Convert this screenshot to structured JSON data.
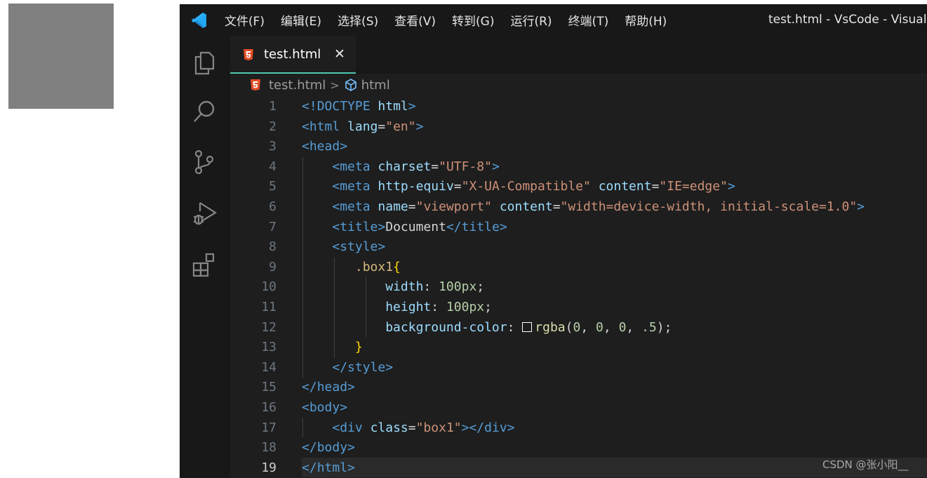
{
  "window": {
    "title": "test.html - VsCode - Visual St",
    "menu": [
      "文件(F)",
      "编辑(E)",
      "选择(S)",
      "查看(V)",
      "转到(G)",
      "运行(R)",
      "终端(T)",
      "帮助(H)"
    ]
  },
  "activity_bar": {
    "icons": [
      "explorer-icon",
      "search-icon",
      "source-control-icon",
      "run-debug-icon",
      "extensions-icon"
    ]
  },
  "tab": {
    "label": "test.html",
    "close": "✕"
  },
  "breadcrumb": {
    "file": "test.html",
    "separator": ">",
    "symbol": "html"
  },
  "editor": {
    "active_line": 19,
    "line_numbers": [
      "1",
      "2",
      "3",
      "4",
      "5",
      "6",
      "7",
      "8",
      "9",
      "10",
      "11",
      "12",
      "13",
      "14",
      "15",
      "16",
      "17",
      "18",
      "19"
    ],
    "lines": [
      [
        {
          "t": "<!",
          "c": "tg"
        },
        {
          "t": "DOCTYPE",
          "c": "tn"
        },
        {
          "t": " ",
          "c": "pn"
        },
        {
          "t": "html",
          "c": "at"
        },
        {
          "t": ">",
          "c": "tg"
        }
      ],
      [
        {
          "t": "<",
          "c": "tg"
        },
        {
          "t": "html",
          "c": "tn"
        },
        {
          "t": " ",
          "c": "pn"
        },
        {
          "t": "lang",
          "c": "at"
        },
        {
          "t": "=",
          "c": "pn"
        },
        {
          "t": "\"en\"",
          "c": "st"
        },
        {
          "t": ">",
          "c": "tg"
        }
      ],
      [
        {
          "t": "<",
          "c": "tg"
        },
        {
          "t": "head",
          "c": "tn"
        },
        {
          "t": ">",
          "c": "tg"
        }
      ],
      [
        {
          "t": "    ",
          "c": "pn"
        },
        {
          "t": "<",
          "c": "tg"
        },
        {
          "t": "meta",
          "c": "tn"
        },
        {
          "t": " ",
          "c": "pn"
        },
        {
          "t": "charset",
          "c": "at"
        },
        {
          "t": "=",
          "c": "pn"
        },
        {
          "t": "\"UTF-8\"",
          "c": "st"
        },
        {
          "t": ">",
          "c": "tg"
        }
      ],
      [
        {
          "t": "    ",
          "c": "pn"
        },
        {
          "t": "<",
          "c": "tg"
        },
        {
          "t": "meta",
          "c": "tn"
        },
        {
          "t": " ",
          "c": "pn"
        },
        {
          "t": "http-equiv",
          "c": "at"
        },
        {
          "t": "=",
          "c": "pn"
        },
        {
          "t": "\"X-UA-Compatible\"",
          "c": "st"
        },
        {
          "t": " ",
          "c": "pn"
        },
        {
          "t": "content",
          "c": "at"
        },
        {
          "t": "=",
          "c": "pn"
        },
        {
          "t": "\"IE=edge\"",
          "c": "st"
        },
        {
          "t": ">",
          "c": "tg"
        }
      ],
      [
        {
          "t": "    ",
          "c": "pn"
        },
        {
          "t": "<",
          "c": "tg"
        },
        {
          "t": "meta",
          "c": "tn"
        },
        {
          "t": " ",
          "c": "pn"
        },
        {
          "t": "name",
          "c": "at"
        },
        {
          "t": "=",
          "c": "pn"
        },
        {
          "t": "\"viewport\"",
          "c": "st"
        },
        {
          "t": " ",
          "c": "pn"
        },
        {
          "t": "content",
          "c": "at"
        },
        {
          "t": "=",
          "c": "pn"
        },
        {
          "t": "\"width=device-width, initial-scale=1.0\"",
          "c": "st"
        },
        {
          "t": ">",
          "c": "tg"
        }
      ],
      [
        {
          "t": "    ",
          "c": "pn"
        },
        {
          "t": "<",
          "c": "tg"
        },
        {
          "t": "title",
          "c": "tn"
        },
        {
          "t": ">",
          "c": "tg"
        },
        {
          "t": "Document",
          "c": "pn"
        },
        {
          "t": "</",
          "c": "tg"
        },
        {
          "t": "title",
          "c": "tn"
        },
        {
          "t": ">",
          "c": "tg"
        }
      ],
      [
        {
          "t": "    ",
          "c": "pn"
        },
        {
          "t": "<",
          "c": "tg"
        },
        {
          "t": "style",
          "c": "tn"
        },
        {
          "t": ">",
          "c": "tg"
        }
      ],
      [
        {
          "t": "       ",
          "c": "pn"
        },
        {
          "t": ".box1",
          "c": "sel"
        },
        {
          "t": "{",
          "c": "br"
        }
      ],
      [
        {
          "t": "           ",
          "c": "pn"
        },
        {
          "t": "width",
          "c": "pr"
        },
        {
          "t": ": ",
          "c": "pn"
        },
        {
          "t": "100px",
          "c": "nm"
        },
        {
          "t": ";",
          "c": "pn"
        }
      ],
      [
        {
          "t": "           ",
          "c": "pn"
        },
        {
          "t": "height",
          "c": "pr"
        },
        {
          "t": ": ",
          "c": "pn"
        },
        {
          "t": "100px",
          "c": "nm"
        },
        {
          "t": ";",
          "c": "pn"
        }
      ],
      [
        {
          "t": "           ",
          "c": "pn"
        },
        {
          "t": "background-color",
          "c": "pr"
        },
        {
          "t": ": ",
          "c": "pn"
        },
        {
          "swatch": true
        },
        {
          "t": "rgba",
          "c": "fn"
        },
        {
          "t": "(",
          "c": "pn"
        },
        {
          "t": "0",
          "c": "nm"
        },
        {
          "t": ", ",
          "c": "pn"
        },
        {
          "t": "0",
          "c": "nm"
        },
        {
          "t": ", ",
          "c": "pn"
        },
        {
          "t": "0",
          "c": "nm"
        },
        {
          "t": ", ",
          "c": "pn"
        },
        {
          "t": ".5",
          "c": "nm"
        },
        {
          "t": ");",
          "c": "pn"
        }
      ],
      [
        {
          "t": "       ",
          "c": "pn"
        },
        {
          "t": "}",
          "c": "br"
        }
      ],
      [
        {
          "t": "    ",
          "c": "pn"
        },
        {
          "t": "</",
          "c": "tg"
        },
        {
          "t": "style",
          "c": "tn"
        },
        {
          "t": ">",
          "c": "tg"
        }
      ],
      [
        {
          "t": "</",
          "c": "tg"
        },
        {
          "t": "head",
          "c": "tn"
        },
        {
          "t": ">",
          "c": "tg"
        }
      ],
      [
        {
          "t": "<",
          "c": "tg"
        },
        {
          "t": "body",
          "c": "tn"
        },
        {
          "t": ">",
          "c": "tg"
        }
      ],
      [
        {
          "t": "    ",
          "c": "pn"
        },
        {
          "t": "<",
          "c": "tg"
        },
        {
          "t": "div",
          "c": "tn"
        },
        {
          "t": " ",
          "c": "pn"
        },
        {
          "t": "class",
          "c": "at"
        },
        {
          "t": "=",
          "c": "pn"
        },
        {
          "t": "\"box1\"",
          "c": "st"
        },
        {
          "t": "></",
          "c": "tg"
        },
        {
          "t": "div",
          "c": "tn"
        },
        {
          "t": ">",
          "c": "tg"
        }
      ],
      [
        {
          "t": "</",
          "c": "tg"
        },
        {
          "t": "body",
          "c": "tn"
        },
        {
          "t": ">",
          "c": "tg"
        }
      ],
      [
        {
          "t": "</",
          "c": "tg"
        },
        {
          "t": "html",
          "c": "tn"
        },
        {
          "t": ">",
          "c": "tg"
        }
      ]
    ]
  },
  "watermark": "CSDN @张小阳__",
  "colors": {
    "accent_tab_border": "#4ec9b0",
    "html_icon": "#e44d26",
    "vscode_blue": "#23a9f2"
  }
}
